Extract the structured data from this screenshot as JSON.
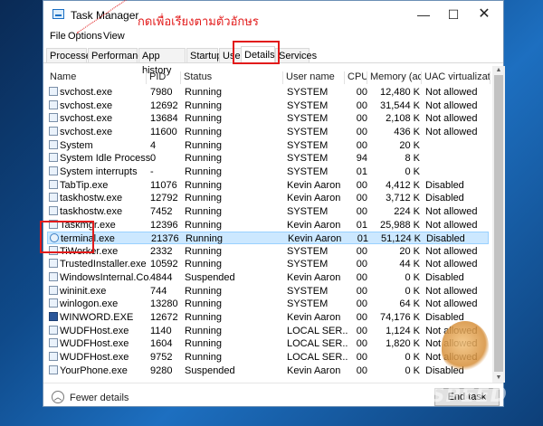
{
  "window": {
    "title": "Task Manager",
    "minimize": "—",
    "maximize": "☐",
    "close": "✕"
  },
  "menu": [
    "File",
    "Options",
    "View"
  ],
  "tabs": [
    {
      "label": "Processes"
    },
    {
      "label": "Performance"
    },
    {
      "label": "App history"
    },
    {
      "label": "Startup"
    },
    {
      "label": "Users"
    },
    {
      "label": "Details",
      "active": true
    },
    {
      "label": "Services"
    }
  ],
  "annotation": "กดเพื่อเรียงตามตัวอักษร",
  "columns": [
    "Name",
    "PID",
    "Status",
    "User name",
    "CPU",
    "Memory (ac...",
    "UAC virtualizati..."
  ],
  "rows": [
    [
      "svchost.exe",
      "7980",
      "Running",
      "SYSTEM",
      "00",
      "12,480 K",
      "Not allowed"
    ],
    [
      "svchost.exe",
      "12692",
      "Running",
      "SYSTEM",
      "00",
      "31,544 K",
      "Not allowed"
    ],
    [
      "svchost.exe",
      "13684",
      "Running",
      "SYSTEM",
      "00",
      "2,108 K",
      "Not allowed"
    ],
    [
      "svchost.exe",
      "11600",
      "Running",
      "SYSTEM",
      "00",
      "436 K",
      "Not allowed"
    ],
    [
      "System",
      "4",
      "Running",
      "SYSTEM",
      "00",
      "20 K",
      ""
    ],
    [
      "System Idle Process",
      "0",
      "Running",
      "SYSTEM",
      "94",
      "8 K",
      ""
    ],
    [
      "System interrupts",
      "-",
      "Running",
      "SYSTEM",
      "01",
      "0 K",
      ""
    ],
    [
      "TabTip.exe",
      "11076",
      "Running",
      "Kevin Aaron",
      "00",
      "4,412 K",
      "Disabled"
    ],
    [
      "taskhostw.exe",
      "12792",
      "Running",
      "Kevin Aaron",
      "00",
      "3,712 K",
      "Disabled"
    ],
    [
      "taskhostw.exe",
      "7452",
      "Running",
      "SYSTEM",
      "00",
      "224 K",
      "Not allowed"
    ],
    [
      "Taskmgr.exe",
      "12396",
      "Running",
      "Kevin Aaron",
      "01",
      "25,988 K",
      "Not allowed"
    ],
    [
      "terminal.exe",
      "21376",
      "Running",
      "Kevin Aaron",
      "01",
      "51,124 K",
      "Disabled"
    ],
    [
      "TiWorker.exe",
      "2332",
      "Running",
      "SYSTEM",
      "00",
      "20 K",
      "Not allowed"
    ],
    [
      "TrustedInstaller.exe",
      "10592",
      "Running",
      "SYSTEM",
      "00",
      "44 K",
      "Not allowed"
    ],
    [
      "WindowsInternal.Co...",
      "4844",
      "Suspended",
      "Kevin Aaron",
      "00",
      "0 K",
      "Disabled"
    ],
    [
      "wininit.exe",
      "744",
      "Running",
      "SYSTEM",
      "00",
      "0 K",
      "Not allowed"
    ],
    [
      "winlogon.exe",
      "13280",
      "Running",
      "SYSTEM",
      "00",
      "64 K",
      "Not allowed"
    ],
    [
      "WINWORD.EXE",
      "12672",
      "Running",
      "Kevin Aaron",
      "00",
      "74,176 K",
      "Disabled"
    ],
    [
      "WUDFHost.exe",
      "1140",
      "Running",
      "LOCAL SER...",
      "00",
      "1,124 K",
      "Not allowed"
    ],
    [
      "WUDFHost.exe",
      "1604",
      "Running",
      "LOCAL SER...",
      "00",
      "1,820 K",
      "Not allowed"
    ],
    [
      "WUDFHost.exe",
      "9752",
      "Running",
      "LOCAL SER...",
      "00",
      "0 K",
      "Not allowed"
    ],
    [
      "YourPhone.exe",
      "9280",
      "Suspended",
      "Kevin Aaron",
      "00",
      "0 K",
      "Disabled"
    ]
  ],
  "selected_row": 11,
  "footer": {
    "fewer_details": "Fewer details",
    "end_task": "End task"
  },
  "watermark": "VPSHISPEED",
  "colors": {
    "annotation_red": "#e21b1b",
    "selection": "#cce8ff",
    "desktop": "#0f4a8a"
  }
}
